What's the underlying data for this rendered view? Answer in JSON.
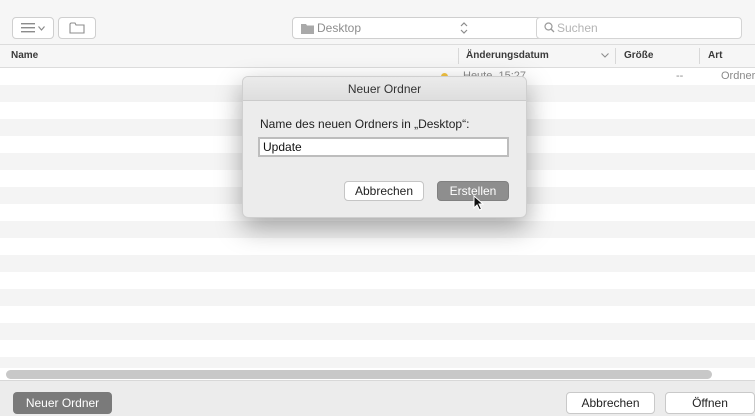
{
  "toolbar": {
    "view_button_icons": [
      "list-icon",
      "chevron-down-icon"
    ],
    "new_folder_icon": "folder-outline-icon",
    "location": "Desktop",
    "search_placeholder": "Suchen"
  },
  "columns": {
    "name": "Name",
    "date": "Änderungsdatum",
    "size": "Größe",
    "kind": "Art"
  },
  "rows": [
    {
      "date": "Heute, 15:27",
      "size": "--",
      "kind": "Ordner",
      "tag_color": "#f5c542"
    }
  ],
  "dialog": {
    "title": "Neuer Ordner",
    "prompt": "Name des neuen Ordners in „Desktop“:",
    "input_value": "Update",
    "cancel_label": "Abbrechen",
    "create_label": "Erstellen"
  },
  "bottom": {
    "new_folder_label": "Neuer Ordner",
    "cancel_label": "Abbrechen",
    "open_label": "Öffnen"
  },
  "colors": {
    "accent_button": "#7a7a7a",
    "tag_yellow": "#f5c542"
  }
}
